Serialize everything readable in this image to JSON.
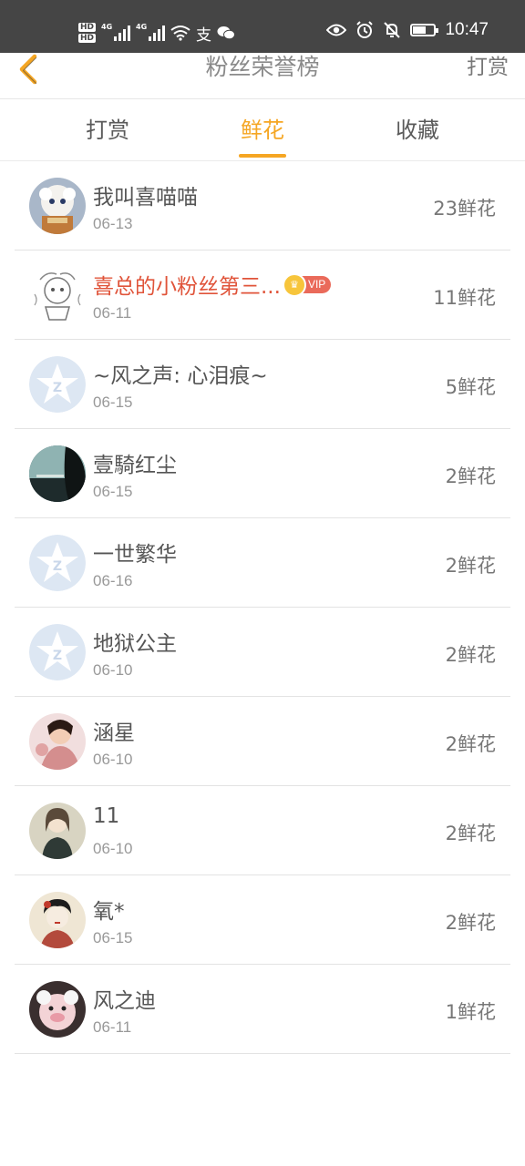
{
  "status_bar": {
    "hd1": "HD",
    "hd2": "HD",
    "net1": "4G",
    "net2": "4G",
    "time": "10:47",
    "battery_level": 0.55,
    "icons": [
      "signal-icon",
      "wifi-icon",
      "alipay-icon",
      "wechat-icon",
      "eye-icon",
      "alarm-icon",
      "mute-bell-icon",
      "battery-icon"
    ]
  },
  "header": {
    "title": "粉丝荣誉榜",
    "action": "打赏",
    "back_icon": "chevron-left-icon"
  },
  "tabs": [
    {
      "label": "打赏",
      "active": false
    },
    {
      "label": "鲜花",
      "active": true
    },
    {
      "label": "收藏",
      "active": false
    }
  ],
  "colors": {
    "accent": "#f5a623",
    "vip_name": "#e0543a",
    "status_bar": "#454545"
  },
  "fans": [
    {
      "name": "我叫喜喵喵",
      "date": "06-13",
      "count": "23鲜花",
      "avatar": "cartoon-sheep-avatar"
    },
    {
      "name": "喜总的小粉丝第三...",
      "date": "06-11",
      "count": "11鲜花",
      "vip": true,
      "vip_label": "VIP",
      "avatar": "sketch-avatar"
    },
    {
      "name": "~风之声: 心泪痕~",
      "date": "06-15",
      "count": "5鲜花",
      "avatar": "default-qq-avatar"
    },
    {
      "name": "壹騎红尘",
      "date": "06-15",
      "count": "2鲜花",
      "avatar": "silhouette-sunset-avatar"
    },
    {
      "name": "一世繁华",
      "date": "06-16",
      "count": "2鲜花",
      "avatar": "default-qq-avatar"
    },
    {
      "name": "地狱公主",
      "date": "06-10",
      "count": "2鲜花",
      "avatar": "default-qq-avatar"
    },
    {
      "name": "涵星",
      "date": "06-10",
      "count": "2鲜花",
      "avatar": "photo-avatar"
    },
    {
      "name": "11",
      "date": "06-10",
      "count": "2鲜花",
      "avatar": "anime-girl-avatar"
    },
    {
      "name": "氧*",
      "date": "06-15",
      "count": "2鲜花",
      "avatar": "geisha-avatar"
    },
    {
      "name": "风之迪",
      "date": "06-11",
      "count": "1鲜花",
      "avatar": "cartoon-pig-avatar"
    }
  ]
}
